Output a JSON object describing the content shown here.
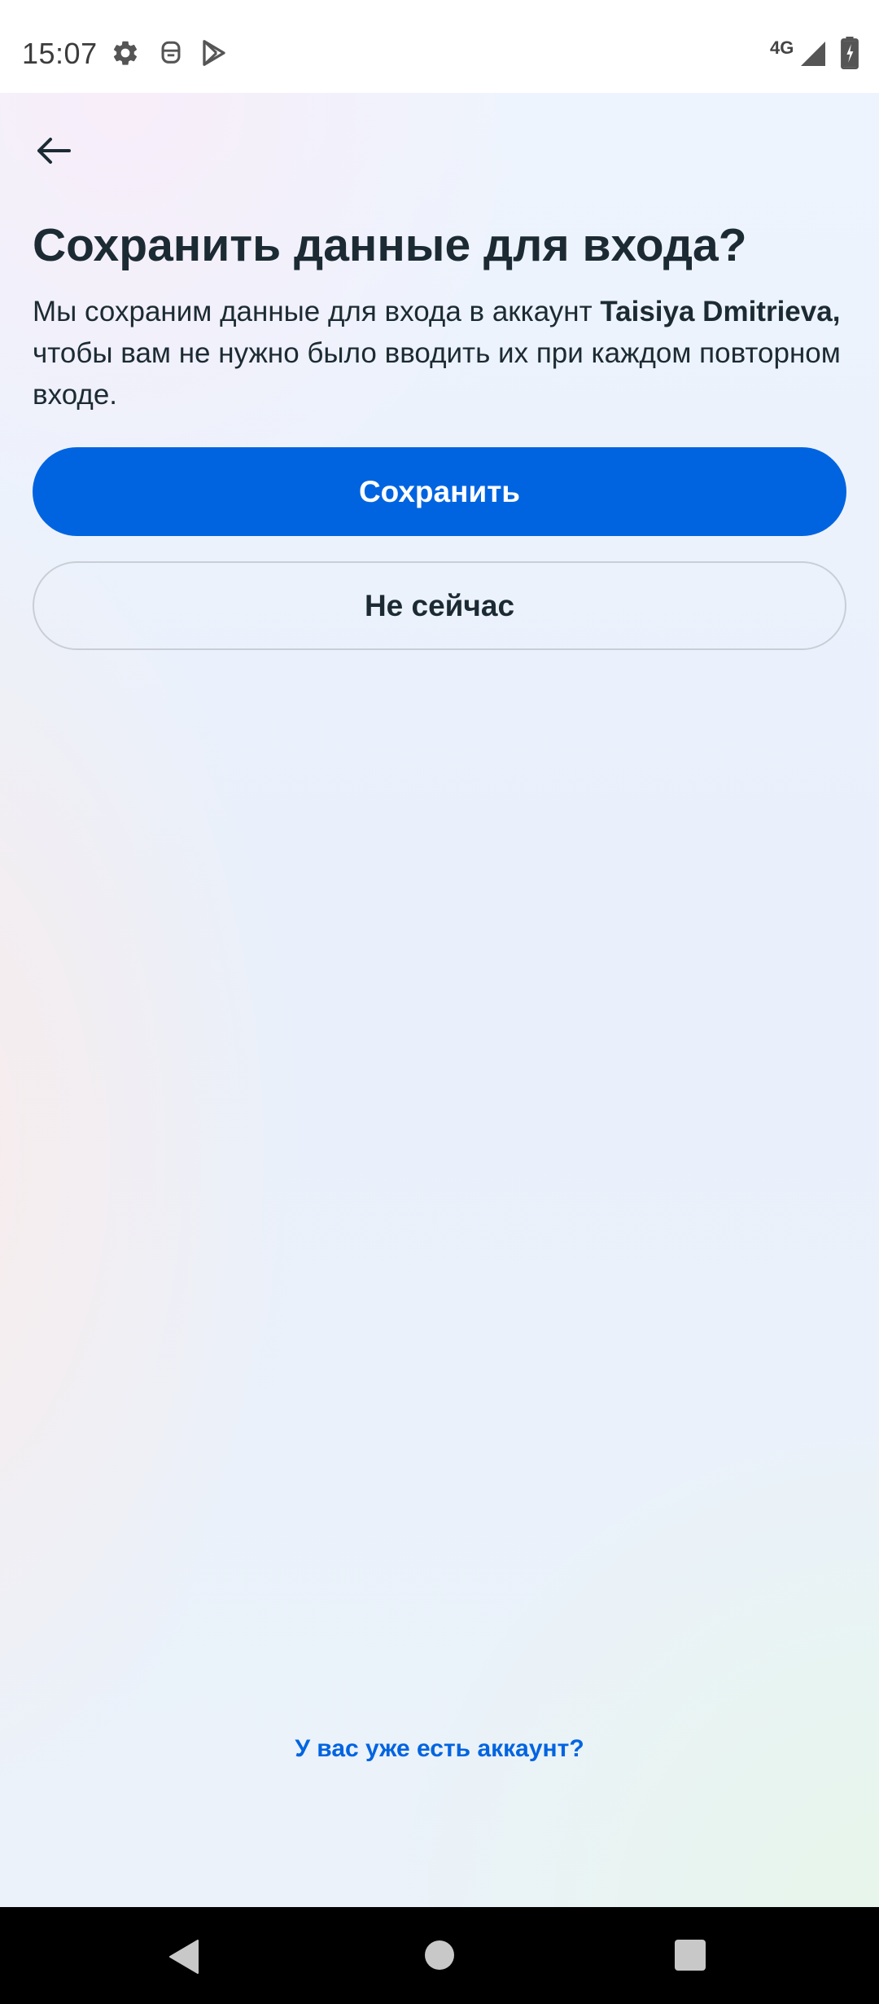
{
  "status_bar": {
    "time": "15:07",
    "network": "4G",
    "icons": [
      "gear-icon",
      "notification-icon",
      "play-store-icon",
      "signal-icon",
      "battery-icon"
    ]
  },
  "header": {
    "back_icon": "arrow-left-icon"
  },
  "main": {
    "title": "Сохранить данные для входа?",
    "description_before": "Мы сохраним данные для входа в аккаунт ",
    "account_name": "Taisiya Dmitrieva,",
    "description_after": " чтобы вам не нужно было вводить их при каждом повторном входе.",
    "save_label": "Сохранить",
    "not_now_label": "Не сейчас"
  },
  "footer": {
    "have_account_link": "У вас уже есть аккаунт?"
  },
  "colors": {
    "primary": "#0064e0",
    "text": "#1c2b33",
    "outline": "#c9ced6"
  },
  "nav_bar": {
    "icons": [
      "back-triangle-icon",
      "home-circle-icon",
      "recents-square-icon"
    ]
  }
}
